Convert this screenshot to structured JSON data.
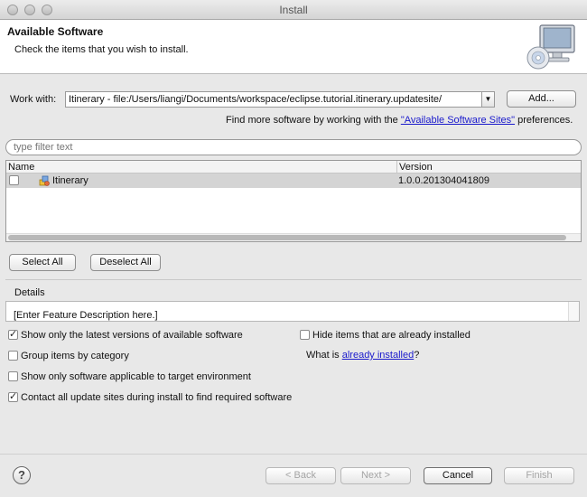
{
  "window": {
    "title": "Install"
  },
  "header": {
    "title": "Available Software",
    "description": "Check the items that you wish to install."
  },
  "work_with": {
    "label": "Work with:",
    "value": "Itinerary - file:/Users/liangi/Documents/workspace/eclipse.tutorial.itinerary.updatesite/",
    "add_label": "Add..."
  },
  "more_software": {
    "prefix": "Find more software by working with the ",
    "link": "\"Available Software Sites\"",
    "suffix": " preferences."
  },
  "filter": {
    "placeholder": "type filter text"
  },
  "table": {
    "columns": [
      "Name",
      "Version"
    ],
    "rows": [
      {
        "name": "Itinerary",
        "version": "1.0.0.201304041809",
        "checked": false,
        "icon": "feature-icon"
      }
    ]
  },
  "selection": {
    "select_all": "Select All",
    "deselect_all": "Deselect All"
  },
  "details": {
    "label": "Details",
    "text": "[Enter Feature Description here.]"
  },
  "options": {
    "show_latest": {
      "label": "Show only the latest versions of available software",
      "checked": true
    },
    "group_by_category": {
      "label": "Group items by category",
      "checked": false
    },
    "show_applicable": {
      "label": "Show only software applicable to target environment",
      "checked": false
    },
    "contact_sites": {
      "label": "Contact all update sites during install to find required software",
      "checked": true
    },
    "hide_installed": {
      "label": "Hide items that are already installed",
      "checked": false
    },
    "what_is": {
      "prefix": "What is ",
      "link": "already installed",
      "suffix": "?"
    }
  },
  "footer": {
    "back": "< Back",
    "next": "Next >",
    "cancel": "Cancel",
    "finish": "Finish",
    "help_icon": "help-icon",
    "help_glyph": "?"
  }
}
